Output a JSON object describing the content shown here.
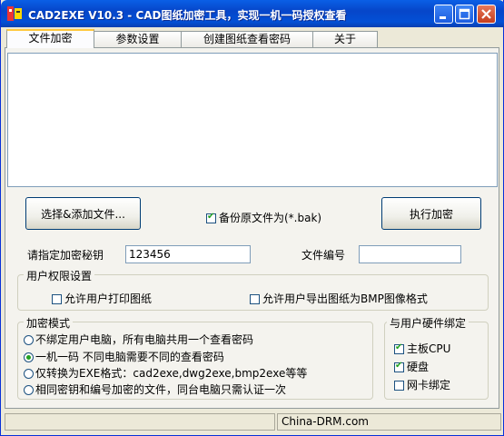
{
  "window": {
    "title": "CAD2EXE V10.3 - CAD图纸加密工具，实现一机一码授权查看"
  },
  "tabs": [
    {
      "label": "文件加密",
      "active": true
    },
    {
      "label": "参数设置",
      "active": false
    },
    {
      "label": "创建图纸查看密码",
      "active": false
    },
    {
      "label": "关于",
      "active": false
    }
  ],
  "actions": {
    "select_label": "选择&添加文件...",
    "backup_label": "备份原文件为(*.bak)",
    "backup_checked": true,
    "encrypt_label": "执行加密"
  },
  "fields": {
    "key_label": "请指定加密秘钥",
    "key_value": "123456",
    "fileno_label": "文件编号",
    "fileno_value": ""
  },
  "permissions": {
    "title": "用户权限设置",
    "print_label": "允许用户打印图纸",
    "print_checked": false,
    "export_label": "允许用户导出图纸为BMP图像格式",
    "export_checked": false
  },
  "mode": {
    "title": "加密模式",
    "options": [
      {
        "label": "不绑定用户电脑，所有电脑共用一个查看密码",
        "selected": false
      },
      {
        "label": "一机一码 不同电脑需要不同的查看密码",
        "selected": true
      },
      {
        "label": "仅转换为EXE格式：cad2exe,dwg2exe,bmp2exe等等",
        "selected": false
      },
      {
        "label": "相同密钥和编号加密的文件，同台电脑只需认证一次",
        "selected": false
      }
    ]
  },
  "hardware": {
    "title": "与用户硬件绑定",
    "items": [
      {
        "label": "主板CPU",
        "checked": true
      },
      {
        "label": "硬盘",
        "checked": true
      },
      {
        "label": "网卡绑定",
        "checked": false
      }
    ]
  },
  "status": {
    "text": "China-DRM.com"
  },
  "colors": {
    "titlebar": "#0a5fe6",
    "face": "#ece9d8",
    "check": "#21a121"
  }
}
